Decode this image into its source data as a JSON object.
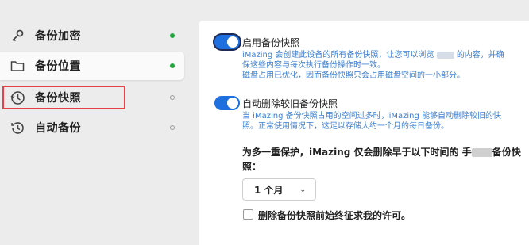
{
  "sidebar": {
    "items": [
      {
        "label": "备份加密",
        "icon": "key-icon",
        "status": "on"
      },
      {
        "label": "备份位置",
        "icon": "folder-icon",
        "status": "on"
      },
      {
        "label": "备份快照",
        "icon": "snapshot-clock-icon",
        "status": "off"
      },
      {
        "label": "自动备份",
        "icon": "clock-icon",
        "status": "off"
      }
    ],
    "selected_index": 2,
    "colors": {
      "on": "#22a53b",
      "off": "#9a9a9a",
      "highlight": "#e8404a"
    }
  },
  "snapshots": {
    "enabled": true,
    "title": "启用备份快照",
    "desc_line1a": "iMazing 会创建此设备的所有备份快照，让您可以浏览",
    "desc_line1b": "的内容，并确",
    "desc_line2": "保这些内容与每次执行备份操作时一致。",
    "desc_line3": "磁盘占用已优化，因而备份快照只会占用磁盘空间的一小部分。"
  },
  "auto_delete": {
    "enabled": true,
    "title": "自动删除较旧备份快照",
    "desc_line1": "当 iMazing 备份快照占用的空间过多时，iMazing 能够自动删除较旧的快",
    "desc_line2": "照。正常使用情况下，这足以存储大约一个月的每日备份。"
  },
  "protection": {
    "text_a": "为多一重保护，iMazing 仅会删除早于以下时间的 手",
    "text_b": "备份快",
    "text_c": "照："
  },
  "period_select": {
    "value": "1 个月"
  },
  "confirm_checkbox": {
    "checked": false,
    "label": "删除备份快照前始终征求我的许可。"
  },
  "accent_color": "#1e6fdf"
}
